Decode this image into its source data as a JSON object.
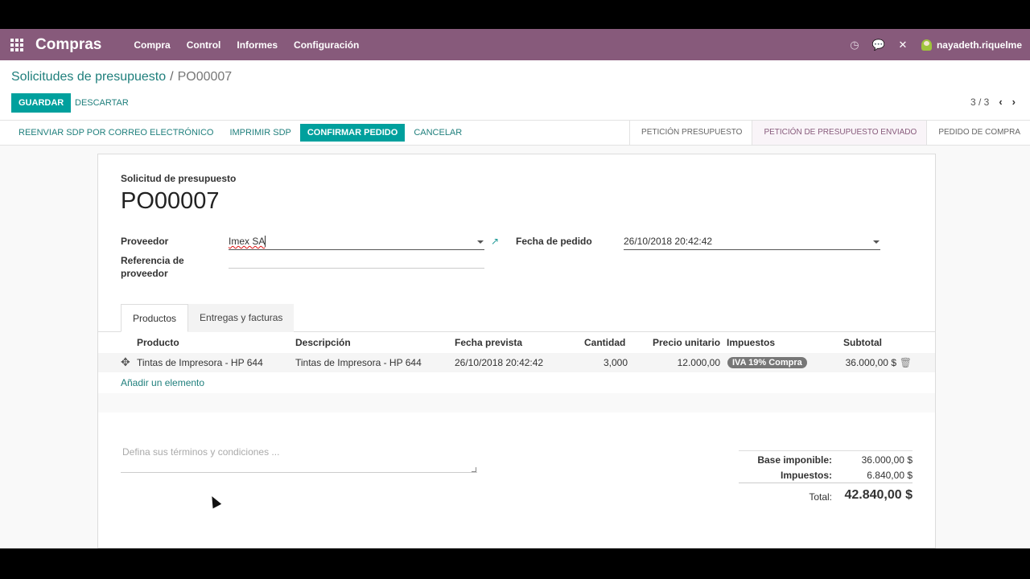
{
  "navbar": {
    "brand": "Compras",
    "menu": [
      "Compra",
      "Control",
      "Informes",
      "Configuración"
    ],
    "user": "nayadeth.riquelme",
    "icons": [
      "clock-icon",
      "chat-icon",
      "close-icon"
    ]
  },
  "breadcrumb": {
    "parent": "Solicitudes de presupuesto",
    "separator": "/",
    "current": "PO00007"
  },
  "actions": {
    "save": "GUARDAR",
    "discard": "DESCARTAR"
  },
  "pager": {
    "value": "3 / 3",
    "prev": "‹",
    "next": "›"
  },
  "statusbar": {
    "buttons": [
      "REENVIAR SDP POR CORREO ELECTRÓNICO",
      "IMPRIMIR SDP",
      "CONFIRMAR PEDIDO",
      "CANCELAR"
    ],
    "stages": [
      "PETICIÓN PRESUPUESTO",
      "PETICIÓN DE PRESUPUESTO ENVIADO",
      "PEDIDO DE COMPRA"
    ],
    "active_stage": 1
  },
  "form": {
    "label": "Solicitud de presupuesto",
    "title": "PO00007",
    "vendor_label": "Proveedor",
    "vendor_value": "Imex SA",
    "vendor_ref_label": "Referencia de proveedor",
    "vendor_ref_value": "",
    "date_label": "Fecha de pedido",
    "date_value": "26/10/2018 20:42:42"
  },
  "tabs": [
    "Productos",
    "Entregas y facturas"
  ],
  "lines": {
    "headers": [
      "Producto",
      "Descripción",
      "Fecha prevista",
      "Cantidad",
      "Precio unitario",
      "Impuestos",
      "Subtotal"
    ],
    "rows": [
      {
        "product": "Tintas de Impresora - HP 644",
        "description": "Tintas de Impresora - HP 644",
        "date": "26/10/2018 20:42:42",
        "qty": "3,000",
        "price": "12.000,00",
        "tax": "IVA 19% Compra",
        "subtotal": "36.000,00 $"
      }
    ],
    "add_item": "Añadir un elemento"
  },
  "notes_placeholder": "Defina sus términos y condiciones ...",
  "totals": {
    "base_label": "Base imponible:",
    "base_value": "36.000,00 $",
    "tax_label": "Impuestos:",
    "tax_value": "6.840,00 $",
    "total_label": "Total:",
    "total_value": "42.840,00 $"
  },
  "colors": {
    "brand": "#875a7b",
    "accent": "#00a09d"
  }
}
